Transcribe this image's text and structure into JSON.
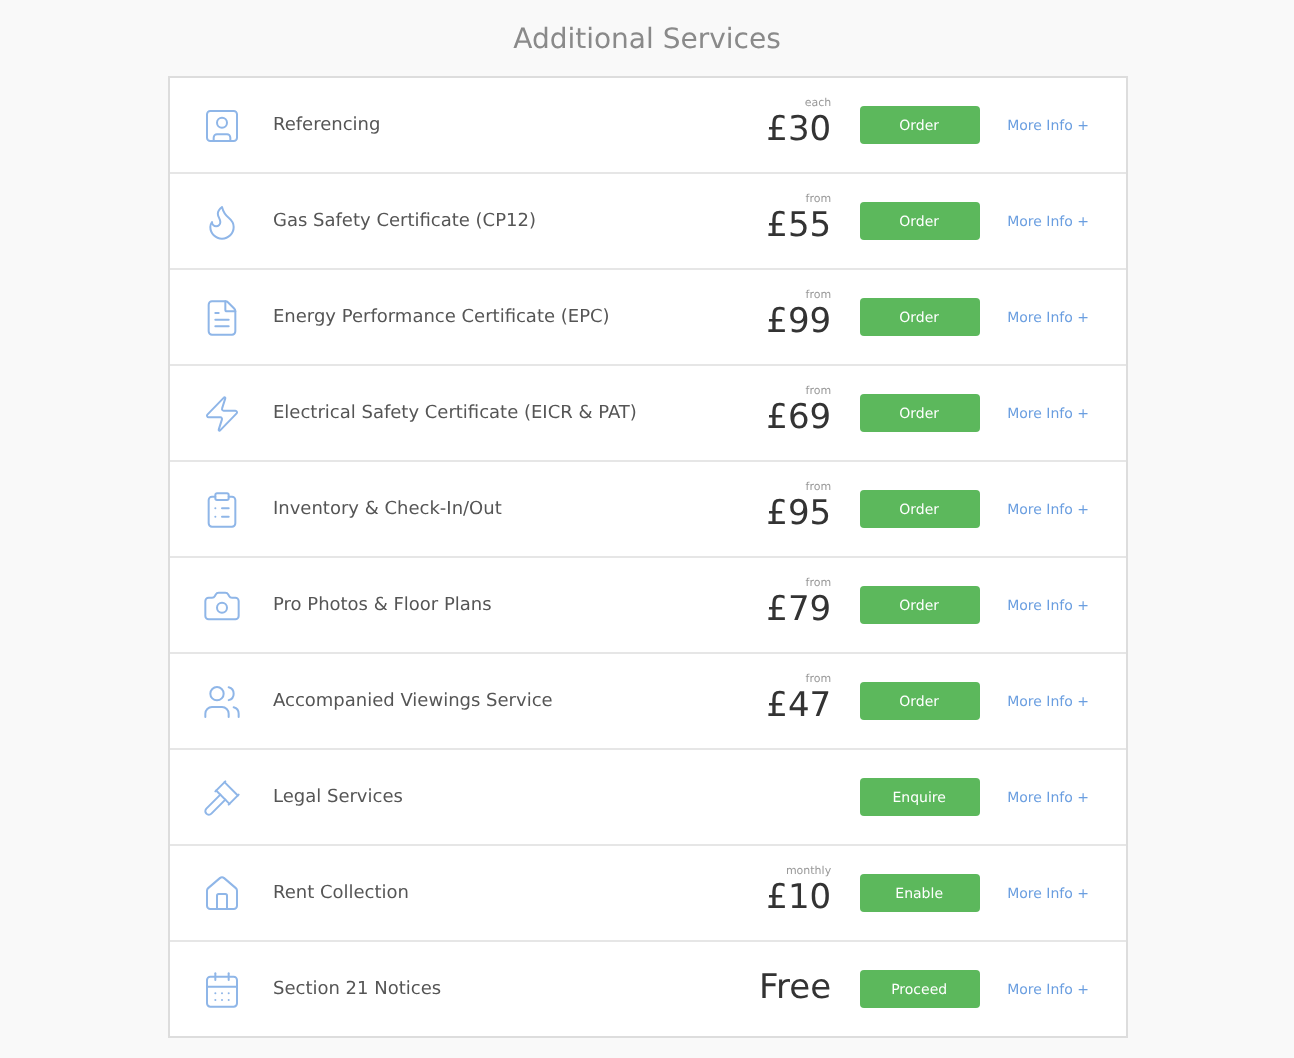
{
  "title": "Additional Services",
  "services": [
    {
      "name": "Referencing",
      "price_note": "each",
      "price": "£30",
      "action": "Order",
      "more": "More Info +"
    },
    {
      "name": "Gas Safety Certificate (CP12)",
      "price_note": "from",
      "price": "£55",
      "action": "Order",
      "more": "More Info +"
    },
    {
      "name": "Energy Performance Certificate (EPC)",
      "price_note": "from",
      "price": "£99",
      "action": "Order",
      "more": "More Info +"
    },
    {
      "name": "Electrical Safety Certificate (EICR & PAT)",
      "price_note": "from",
      "price": "£69",
      "action": "Order",
      "more": "More Info +"
    },
    {
      "name": "Inventory & Check-In/Out",
      "price_note": "from",
      "price": "£95",
      "action": "Order",
      "more": "More Info +"
    },
    {
      "name": "Pro Photos & Floor Plans",
      "price_note": "from",
      "price": "£79",
      "action": "Order",
      "more": "More Info +"
    },
    {
      "name": "Accompanied Viewings Service",
      "price_note": "from",
      "price": "£47",
      "action": "Order",
      "more": "More Info +"
    },
    {
      "name": "Legal Services",
      "action": "Enquire",
      "more": "More Info +"
    },
    {
      "name": "Rent Collection",
      "price_note": "monthly",
      "price": "£10",
      "action": "Enable",
      "more": "More Info +"
    },
    {
      "name": "Section 21 Notices",
      "price": "Free",
      "action": "Proceed",
      "more": "More Info +"
    }
  ]
}
